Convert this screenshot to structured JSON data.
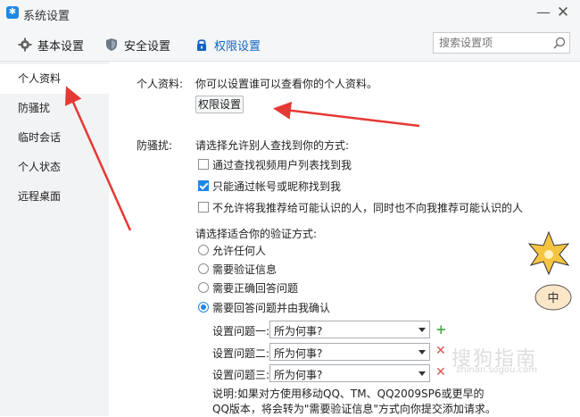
{
  "window": {
    "title": "系统设置",
    "minimize": "—",
    "close": "✕"
  },
  "toolbar": {
    "tabs": [
      {
        "label": "基本设置",
        "icon": "gear-icon"
      },
      {
        "label": "安全设置",
        "icon": "shield-icon"
      },
      {
        "label": "权限设置",
        "icon": "lock-icon",
        "active": true
      }
    ],
    "search": {
      "placeholder": "搜索设置项"
    }
  },
  "sidebar": {
    "items": [
      {
        "label": "个人资料",
        "active": true
      },
      {
        "label": "防骚扰"
      },
      {
        "label": "临时会话"
      },
      {
        "label": "个人状态"
      },
      {
        "label": "远程桌面"
      }
    ]
  },
  "profile": {
    "label": "个人资料:",
    "description": "你可以设置谁可以查看你的个人资料。",
    "button": "权限设置"
  },
  "harass": {
    "label": "防骚扰:",
    "find_prompt": "请选择允许别人查找到你的方式:",
    "find_options": [
      {
        "label": "通过查找视频用户列表找到我",
        "checked": false
      },
      {
        "label": "只能通过帐号或昵称找到我",
        "checked": true
      },
      {
        "label": "不允许将我推荐给可能认识的人，同时也不向我推荐可能认识的人",
        "checked": false
      }
    ],
    "verify_prompt": "请选择适合你的验证方式:",
    "verify_options": [
      {
        "label": "允许任何人",
        "selected": false
      },
      {
        "label": "需要验证信息",
        "selected": false
      },
      {
        "label": "需要正确回答问题",
        "selected": false
      },
      {
        "label": "需要回答问题并由我确认",
        "selected": true
      }
    ],
    "questions": [
      {
        "label": "设置问题一:",
        "value": "所为何事?",
        "action": "+"
      },
      {
        "label": "设置问题二:",
        "value": "所为何事?",
        "action": "✕"
      },
      {
        "label": "设置问题三:",
        "value": "所为何事?",
        "action": "✕"
      }
    ],
    "note": "说明:如果对方使用移动QQ、TM、QQ2009SP6或更早的QQ版本，将会转为\"需要验证信息\"方式向你提交添加请求。"
  },
  "watermark": {
    "text": "搜狗指南",
    "sub": "zhinan.sogou.com"
  },
  "mascot": {
    "text": "中"
  },
  "colors": {
    "accent": "#1e88e5",
    "arrow": "#e53935",
    "sidebar_bg": "#f2f3f5"
  }
}
